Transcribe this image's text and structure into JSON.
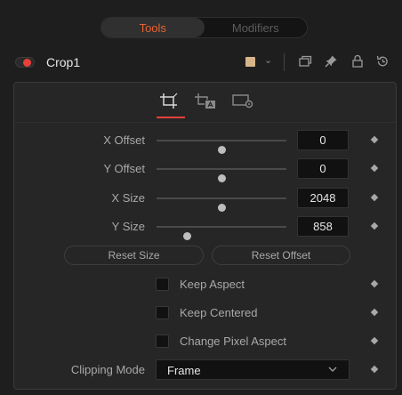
{
  "tabs": [
    {
      "label": "Tools",
      "active": true
    },
    {
      "label": "Modifiers",
      "active": false
    }
  ],
  "header": {
    "node_name": "Crop1",
    "enabled": true,
    "swatch_color": "#d6b58a"
  },
  "controls": {
    "x_offset": {
      "label": "X Offset",
      "value": "0",
      "slider_level": 0.5
    },
    "y_offset": {
      "label": "Y Offset",
      "value": "0",
      "slider_level": 0.5
    },
    "x_size": {
      "label": "X Size",
      "value": "2048",
      "slider_level": 0.5
    },
    "y_size": {
      "label": "Y Size",
      "value": "858",
      "slider_level": 0.23
    }
  },
  "buttons": {
    "reset_size": "Reset Size",
    "reset_offset": "Reset Offset"
  },
  "checkboxes": {
    "keep_aspect": {
      "label": "Keep Aspect",
      "checked": false
    },
    "keep_centered": {
      "label": "Keep Centered",
      "checked": false
    },
    "change_pixel_aspect": {
      "label": "Change Pixel Aspect",
      "checked": false
    }
  },
  "clipping_mode": {
    "label": "Clipping Mode",
    "value": "Frame"
  },
  "colors": {
    "accent_red": "#e6413a",
    "active_tab_text": "#e8612c",
    "background": "#1e1e1e",
    "panel": "#262626"
  },
  "icons": {
    "header_right": [
      "window-icon",
      "pin-icon",
      "lock-icon",
      "reset-icon"
    ],
    "subtabs": [
      "crop-icon",
      "crop-auto-icon",
      "frame-settings-icon"
    ]
  }
}
